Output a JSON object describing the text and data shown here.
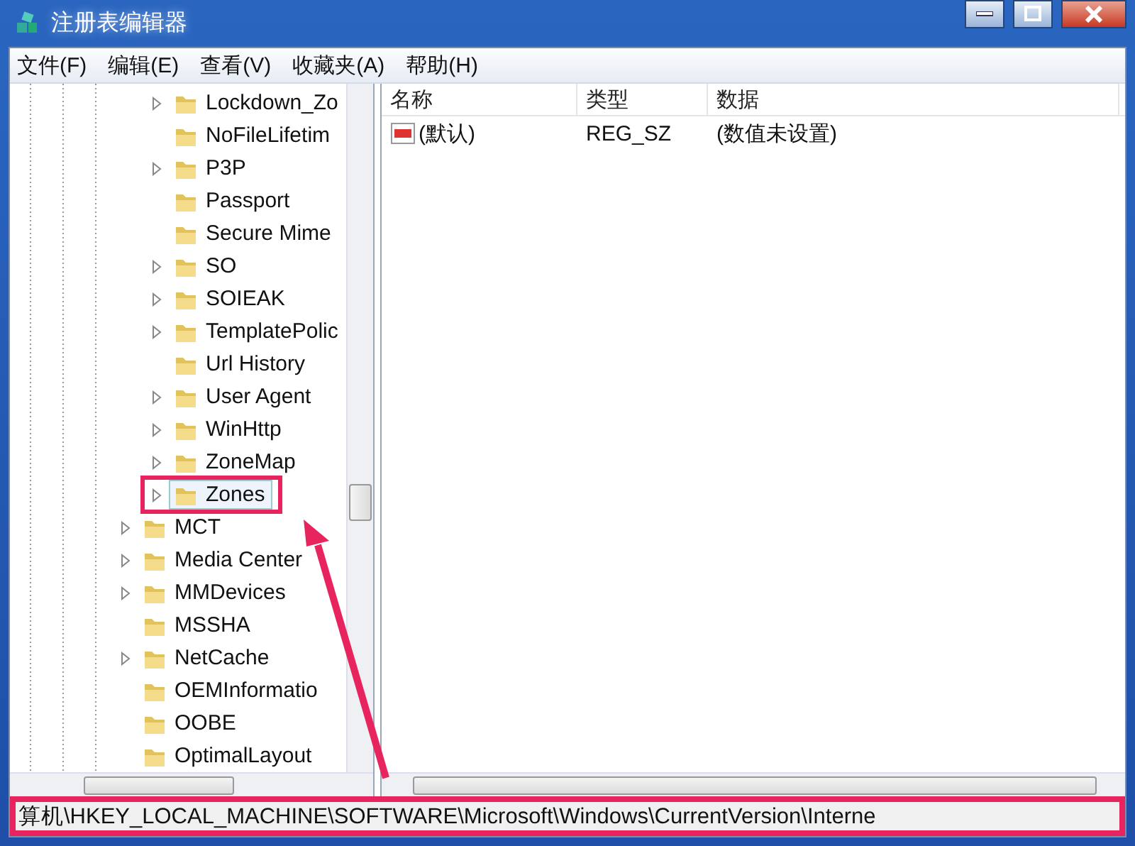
{
  "window": {
    "title": "注册表编辑器"
  },
  "menu": [
    "文件(F)",
    "编辑(E)",
    "查看(V)",
    "收藏夹(A)",
    "帮助(H)"
  ],
  "tree": [
    {
      "children": [
        {
          "label": "Lockdown_Zo",
          "expander": true,
          "selected": false,
          "highlighted": false
        },
        {
          "label": "NoFileLifetim",
          "expander": false,
          "selected": false,
          "highlighted": false
        },
        {
          "label": "P3P",
          "expander": true,
          "selected": false,
          "highlighted": false
        },
        {
          "label": "Passport",
          "expander": false,
          "selected": false,
          "highlighted": false
        },
        {
          "label": "Secure Mime",
          "expander": false,
          "selected": false,
          "highlighted": false
        },
        {
          "label": "SO",
          "expander": true,
          "selected": false,
          "highlighted": false
        },
        {
          "label": "SOIEAK",
          "expander": true,
          "selected": false,
          "highlighted": false
        },
        {
          "label": "TemplatePolic",
          "expander": true,
          "selected": false,
          "highlighted": false
        },
        {
          "label": "Url History",
          "expander": false,
          "selected": false,
          "highlighted": false
        },
        {
          "label": "User Agent",
          "expander": true,
          "selected": false,
          "highlighted": false
        },
        {
          "label": "WinHttp",
          "expander": true,
          "selected": false,
          "highlighted": false
        },
        {
          "label": "ZoneMap",
          "expander": true,
          "selected": false,
          "highlighted": false
        },
        {
          "label": "Zones",
          "expander": true,
          "selected": true,
          "highlighted": true
        }
      ]
    },
    {
      "label": "MCT",
      "expander": true,
      "selected": false,
      "highlighted": false
    },
    {
      "label": "Media Center",
      "expander": true,
      "selected": false,
      "highlighted": false
    },
    {
      "label": "MMDevices",
      "expander": true,
      "selected": false,
      "highlighted": false
    },
    {
      "label": "MSSHA",
      "expander": false,
      "selected": false,
      "highlighted": false
    },
    {
      "label": "NetCache",
      "expander": true,
      "selected": false,
      "highlighted": false
    },
    {
      "label": "OEMInformatio",
      "expander": false,
      "selected": false,
      "highlighted": false
    },
    {
      "label": "OOBE",
      "expander": false,
      "selected": false,
      "highlighted": false
    },
    {
      "label": "OptimalLayout",
      "expander": false,
      "selected": false,
      "highlighted": false
    }
  ],
  "table": {
    "columns": [
      "名称",
      "类型",
      "数据"
    ],
    "rows": [
      [
        "(默认)",
        "REG_SZ",
        "(数值未设置)"
      ]
    ]
  },
  "status_bar": {
    "path": "算机\\HKEY_LOCAL_MACHINE\\SOFTWARE\\Microsoft\\Windows\\CurrentVersion\\Interne",
    "highlighted": true
  }
}
